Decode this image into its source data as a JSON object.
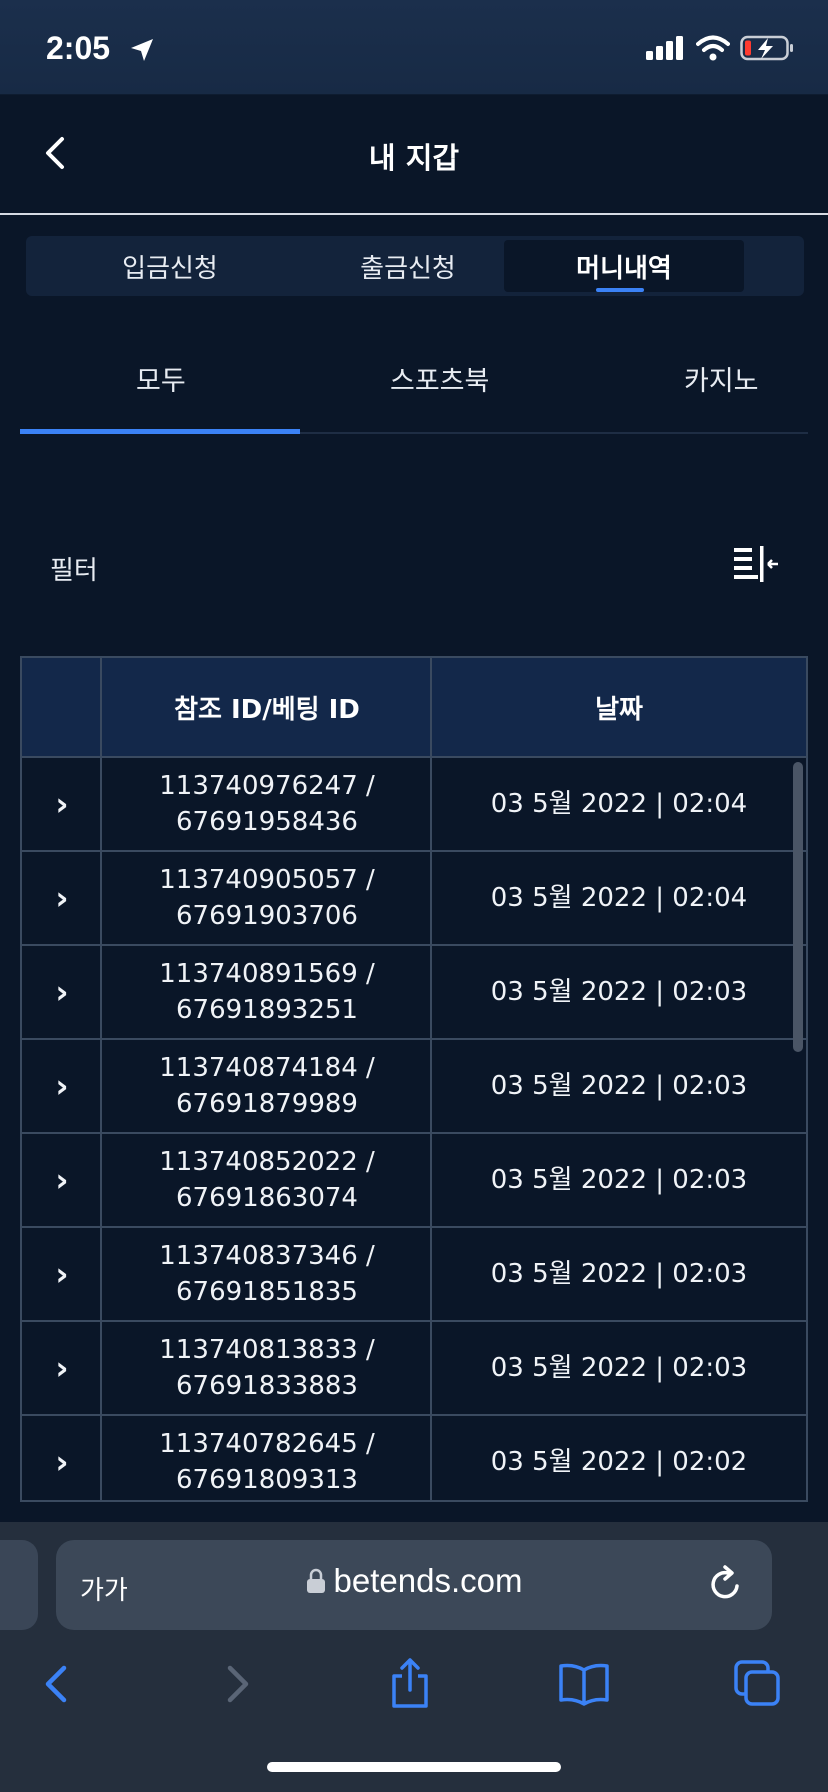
{
  "status_bar": {
    "time": "2:05"
  },
  "header": {
    "title": "내 지갑"
  },
  "wallet_tabs": [
    {
      "label": "입금신청"
    },
    {
      "label": "출금신청"
    },
    {
      "label": "머니내역"
    }
  ],
  "category_tabs": [
    {
      "label": "모두"
    },
    {
      "label": "스포츠북"
    },
    {
      "label": "카지노"
    }
  ],
  "filter": {
    "label": "필터"
  },
  "table": {
    "headers": {
      "ref_id": "참조 ID/베팅 ID",
      "date": "날짜"
    },
    "rows": [
      {
        "ref": "113740976247 /",
        "bet": "67691958436",
        "date": "03 5월 2022 | 02:04"
      },
      {
        "ref": "113740905057 /",
        "bet": "67691903706",
        "date": "03 5월 2022 | 02:04"
      },
      {
        "ref": "113740891569 /",
        "bet": "67691893251",
        "date": "03 5월 2022 | 02:03"
      },
      {
        "ref": "113740874184 /",
        "bet": "67691879989",
        "date": "03 5월 2022 | 02:03"
      },
      {
        "ref": "113740852022 /",
        "bet": "67691863074",
        "date": "03 5월 2022 | 02:03"
      },
      {
        "ref": "113740837346 /",
        "bet": "67691851835",
        "date": "03 5월 2022 | 02:03"
      },
      {
        "ref": "113740813833 /",
        "bet": "67691833883",
        "date": "03 5월 2022 | 02:03"
      },
      {
        "ref": "113740782645 /",
        "bet": "67691809313",
        "date": "03 5월 2022 | 02:02"
      }
    ]
  },
  "browser": {
    "text_size_label": "가가",
    "url": "betends.com"
  },
  "colors": {
    "accent": "#3b82f6",
    "background": "#0a1628",
    "table_header": "#13284a"
  }
}
